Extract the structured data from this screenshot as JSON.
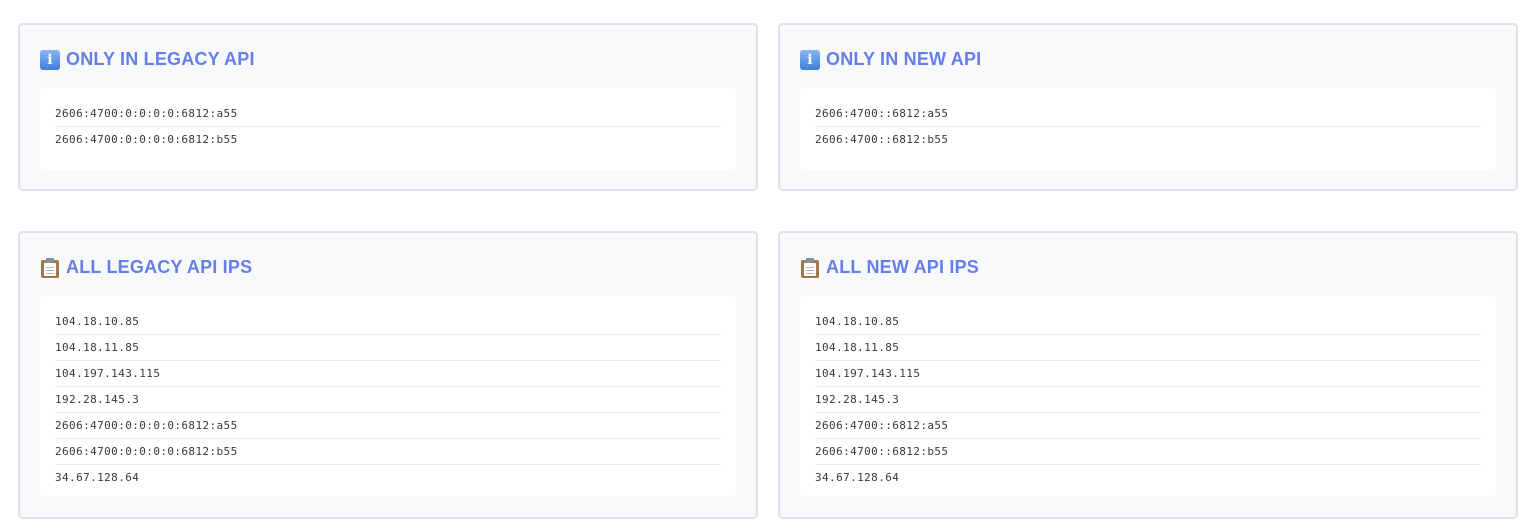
{
  "panels": {
    "only_legacy": {
      "title": "ONLY IN LEGACY API",
      "icon": "info-icon",
      "items": [
        "2606:4700:0:0:0:0:6812:a55",
        "2606:4700:0:0:0:0:6812:b55"
      ]
    },
    "only_new": {
      "title": "ONLY IN NEW API",
      "icon": "info-icon",
      "items": [
        "2606:4700::6812:a55",
        "2606:4700::6812:b55"
      ]
    },
    "all_legacy": {
      "title": "ALL LEGACY API IPS",
      "icon": "clipboard-icon",
      "items": [
        "104.18.10.85",
        "104.18.11.85",
        "104.197.143.115",
        "192.28.145.3",
        "2606:4700:0:0:0:0:6812:a55",
        "2606:4700:0:0:0:0:6812:b55",
        "34.67.128.64"
      ]
    },
    "all_new": {
      "title": "ALL NEW API IPS",
      "icon": "clipboard-icon",
      "items": [
        "104.18.10.85",
        "104.18.11.85",
        "104.197.143.115",
        "192.28.145.3",
        "2606:4700::6812:a55",
        "2606:4700::6812:b55",
        "34.67.128.64"
      ]
    }
  },
  "colors": {
    "title": "#667eea",
    "panel_bg": "#f8f9fa",
    "panel_border": "#dee2e6",
    "list_bg": "#ffffff",
    "text": "#343a40"
  }
}
